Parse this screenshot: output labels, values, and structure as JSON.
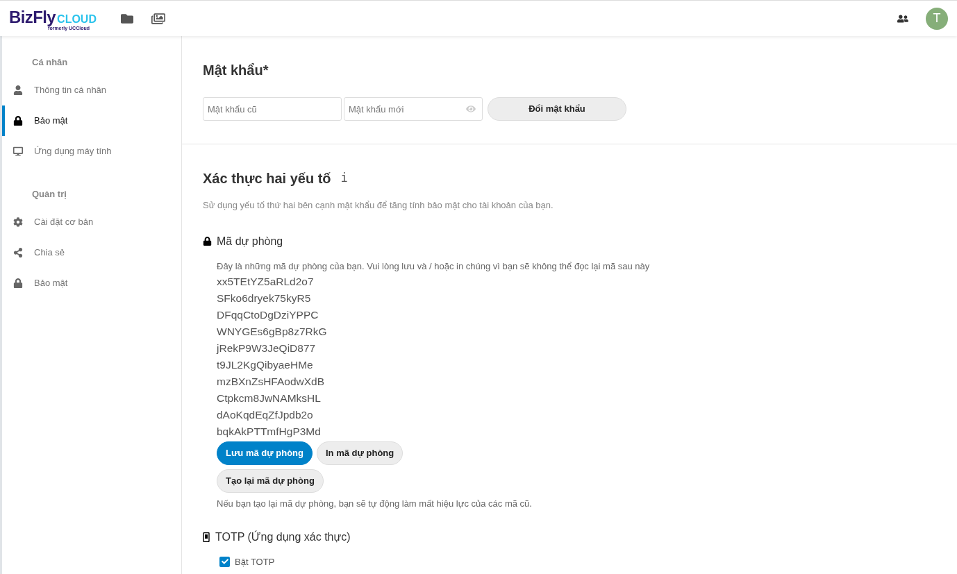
{
  "header": {
    "logo": {
      "brand": "BizFly",
      "suffix": "CLOUD",
      "tagline": "formerly UCCloud"
    },
    "avatar": {
      "initial": "T"
    }
  },
  "sidebar": {
    "sections": [
      {
        "title": "Cá nhân",
        "items": [
          {
            "label": "Thông tin cá nhân",
            "selected": false
          },
          {
            "label": "Bảo mật",
            "selected": true
          },
          {
            "label": "Ứng dụng máy tính",
            "selected": false
          }
        ]
      },
      {
        "title": "Quản trị",
        "items": [
          {
            "label": "Cài đặt cơ bản",
            "selected": false
          },
          {
            "label": "Chia sẻ",
            "selected": false
          },
          {
            "label": "Bảo mật",
            "selected": false
          }
        ]
      }
    ]
  },
  "password": {
    "title": "Mật khẩu*",
    "old_placeholder": "Mật khẩu cũ",
    "new_placeholder": "Mật khẩu mới",
    "button": "Đổi mật khẩu"
  },
  "two_factor": {
    "title": "Xác thực hai yếu tố",
    "info": "i",
    "description": "Sử dụng yếu tố thứ hai bên cạnh mật khẩu để tăng tính bảo mật cho tài khoản của bạn.",
    "backup": {
      "title": "Mã dự phòng",
      "intro": "Đây là những mã dự phòng của bạn. Vui lòng lưu và / hoặc in chúng vì bạn sẽ không thể đọc lại mã sau này",
      "codes": [
        "xx5TEtYZ5aRLd2o7",
        "SFko6dryek75kyR5",
        "DFqqCtoDgDziYPPC",
        "WNYGEs6gBp8z7RkG",
        "jRekP9W3JeQiD877",
        "t9JL2KgQibyaeHMe",
        "mzBXnZsHFAodwXdB",
        "Ctpkcm8JwNAMksHL",
        "dAoKqdEqZfJpdb2o",
        "bqkAkPTTmfHgP3Md"
      ],
      "buttons": [
        {
          "label": "Lưu mã dự phòng",
          "kind": "primary"
        },
        {
          "label": "In mã dự phòng",
          "kind": "secondary"
        },
        {
          "label": "Tạo lại mã dự phòng",
          "kind": "secondary"
        }
      ],
      "note": "Nếu bạn tạo lại mã dự phòng, bạn sẽ tự động làm mất hiệu lực của các mã cũ."
    },
    "totp": {
      "title": "TOTP (Ứng dụng xác thực)",
      "checkbox": {
        "label": "Bật TOTP",
        "checked": true
      }
    }
  }
}
